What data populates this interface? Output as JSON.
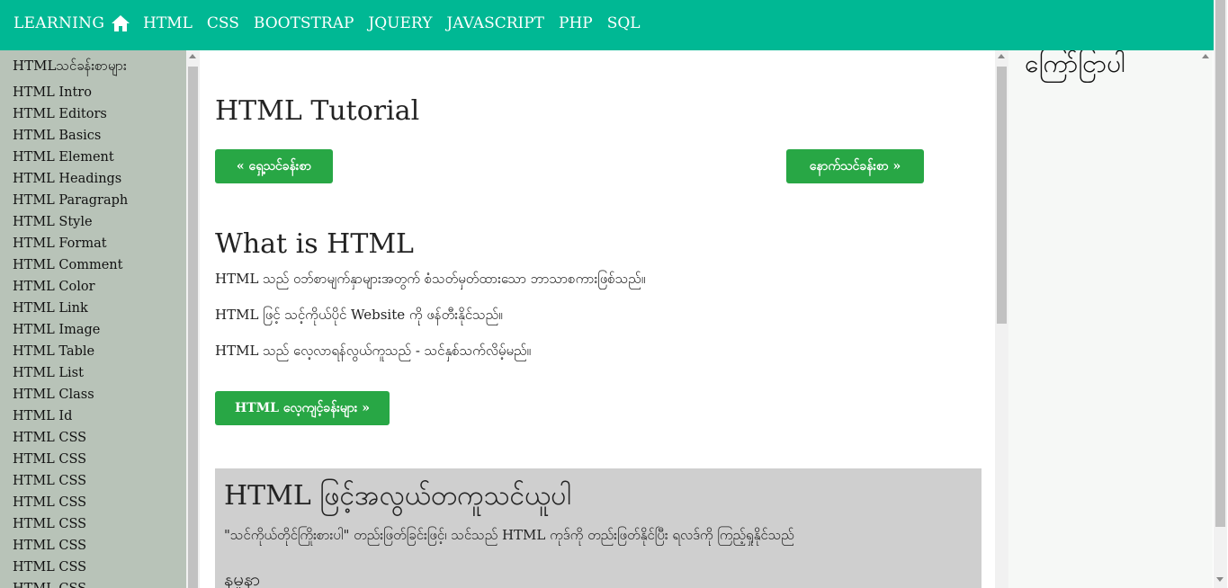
{
  "nav": {
    "brand": "LEARNING",
    "home_icon": "home-icon",
    "links": [
      "HTML",
      "CSS",
      "BOOTSTRAP",
      "JQUERY",
      "JAVASCRIPT",
      "PHP",
      "SQL"
    ]
  },
  "sidebar": {
    "title": "HTMLသင်ခန်းစာများ",
    "items": [
      "HTML Intro",
      "HTML Editors",
      "HTML Basics",
      "HTML Element",
      "HTML Headings",
      "HTML Paragraph",
      "HTML Style",
      "HTML Format",
      "HTML Comment",
      "HTML Color",
      "HTML Link",
      "HTML Image",
      "HTML Table",
      "HTML List",
      "HTML Class",
      "HTML Id",
      "HTML CSS",
      "HTML CSS",
      "HTML CSS",
      "HTML CSS",
      "HTML CSS",
      "HTML CSS",
      "HTML CSS",
      "HTML CSS"
    ]
  },
  "main": {
    "title": "HTML Tutorial",
    "prev_label": "« ရှေ့သင်ခန်းစာ",
    "next_label": "နောက်သင်ခန်းစာ »",
    "section_title": "What is HTML",
    "paragraphs": [
      "HTML သည် ဝဘ်စာမျက်နှာများအတွက် စံသတ်မှတ်ထားသော ဘာသာစကားဖြစ်သည်။",
      "HTML ဖြင့် သင့်ကိုယ်ပိုင် Website ကို ဖန်တီးနိုင်သည်။",
      "HTML သည် လေ့လာရန်လွယ်ကူသည် - သင်နှစ်သက်လိမ့်မည်။"
    ],
    "examples_label": "HTML လေ့ကျင့်ခန်းများ »",
    "box": {
      "heading": "HTML ဖြင့်အလွယ်တကူသင်ယူပါ",
      "text": "\"သင်ကိုယ်တိုင်ကြိုးစားပါ\" တည်းဖြတ်ခြင်းဖြင့်၊ သင်သည် HTML ကုဒ်ကို တည်းဖြတ်နိုင်ပြီး ရလဒ်ကို ကြည့်ရှုနိုင်သည်",
      "subheading": "နမူနာ"
    }
  },
  "right_panel": {
    "ad_text": "ကြော်ငြာပါ"
  },
  "colors": {
    "nav_bg": "#00b894",
    "sidebar_bg": "#b8c3b8",
    "button_bg": "#28a745",
    "box_bg": "#cfcfcf"
  }
}
